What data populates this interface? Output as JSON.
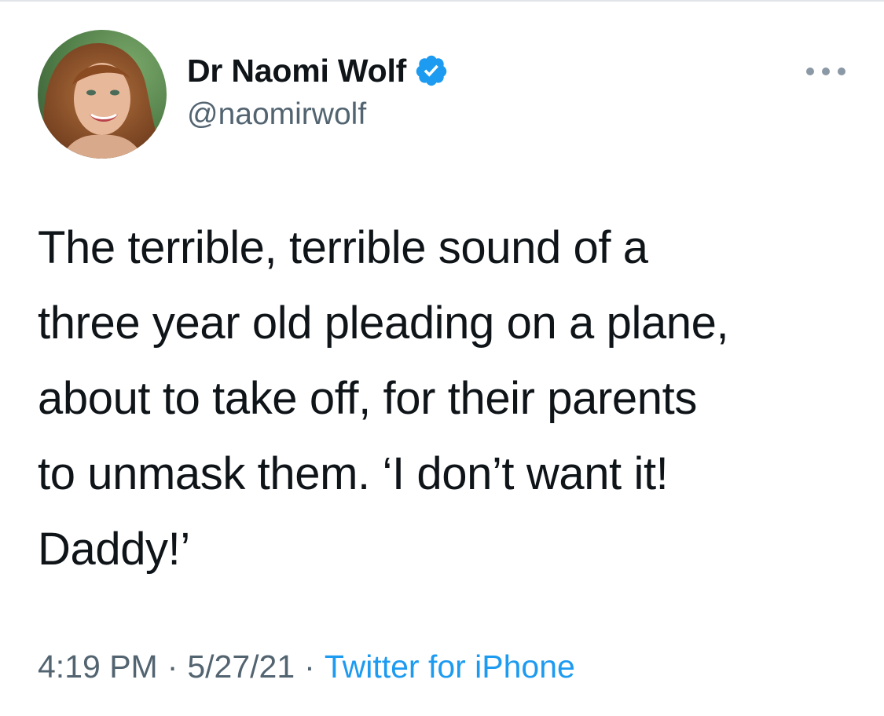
{
  "tweet": {
    "author": {
      "display_name": "Dr Naomi Wolf",
      "handle": "@naomirwolf",
      "verified": true,
      "verified_icon": "verified-badge-icon",
      "avatar": "profile-photo"
    },
    "more_icon": "more-options-icon",
    "text": "The terrible, terrible sound of a\nthree year old pleading on a plane,\nabout to take off, for their parents\nto unmask them. ‘I don’t want it!\nDaddy!’",
    "time": "4:19 PM",
    "separator": "·",
    "date": "5/27/21",
    "source": "Twitter for iPhone"
  },
  "colors": {
    "text_primary": "#0f1419",
    "text_secondary": "#536471",
    "link": "#1d9bf0",
    "verified": "#1d9bf0"
  }
}
